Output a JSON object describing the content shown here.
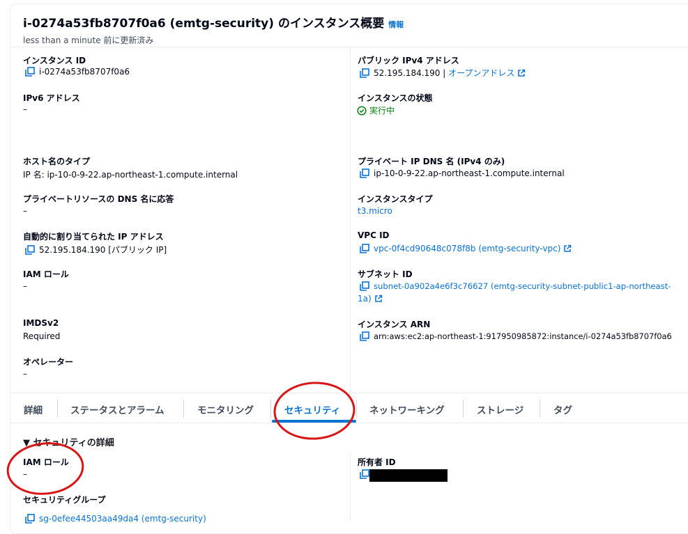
{
  "header": {
    "title": "i-0274a53fb8707f0a6 (emtg-security) のインスタンス概要",
    "info_link": "情報",
    "updated": "less than a minute 前に更新済み"
  },
  "details": {
    "instance_id": {
      "label": "インスタンス ID",
      "value": "i-0274a53fb8707f0a6"
    },
    "public_ipv4": {
      "label": "パブリック IPv4 アドレス",
      "value": "52.195.184.190",
      "sep": " | ",
      "link": "オープンアドレス"
    },
    "ipv6": {
      "label": "IPv6 アドレス",
      "value": "–"
    },
    "state": {
      "label": "インスタンスの状態",
      "value": "実行中"
    },
    "hostname_type": {
      "label": "ホスト名のタイプ",
      "value": "IP 名: ip-10-0-9-22.ap-northeast-1.compute.internal"
    },
    "private_dns": {
      "label": "プライベート IP DNS 名 (IPv4 のみ)",
      "value": "ip-10-0-9-22.ap-northeast-1.compute.internal"
    },
    "resource_dns": {
      "label": "プライベートリソースの DNS 名に応答",
      "value": "–"
    },
    "instance_type": {
      "label": "インスタンスタイプ",
      "value": "t3.micro"
    },
    "auto_ip": {
      "label": "自動的に割り当てられた IP アドレス",
      "value": "52.195.184.190 [パブリック IP]"
    },
    "vpc_id": {
      "label": "VPC ID",
      "value": "vpc-0f4cd90648c078f8b (emtg-security-vpc)"
    },
    "iam_role": {
      "label": "IAM ロール",
      "value": "–"
    },
    "subnet_id": {
      "label": "サブネット ID",
      "line1": "subnet-0a902a4e6f3c76627 (emtg-security-subnet-public1-ap-northeast-",
      "line2": "1a)"
    },
    "imdsv2": {
      "label": "IMDSv2",
      "value": "Required"
    },
    "instance_arn": {
      "label": "インスタンス ARN",
      "value": "arn:aws:ec2:ap-northeast-1:917950985872:instance/i-0274a53fb8707f0a6"
    },
    "operator": {
      "label": "オペレーター",
      "value": "–"
    }
  },
  "tabs": [
    "詳細",
    "ステータスとアラーム",
    "モニタリング",
    "セキュリティ",
    "ネットワーキング",
    "ストレージ",
    "タグ"
  ],
  "active_tab": "セキュリティ",
  "security": {
    "section_title": "▼ セキュリティの詳細",
    "iam_role": {
      "label": "IAM ロール",
      "value": "–"
    },
    "owner_id": {
      "label": "所有者 ID"
    },
    "security_groups": {
      "label": "セキュリティグループ",
      "value": "sg-0efee44503aa49da4 (emtg-security)"
    }
  },
  "colors": {
    "link": "#0972d3",
    "success": "#037f0c",
    "annotation": "#d91515",
    "border": "#e9ebed"
  }
}
